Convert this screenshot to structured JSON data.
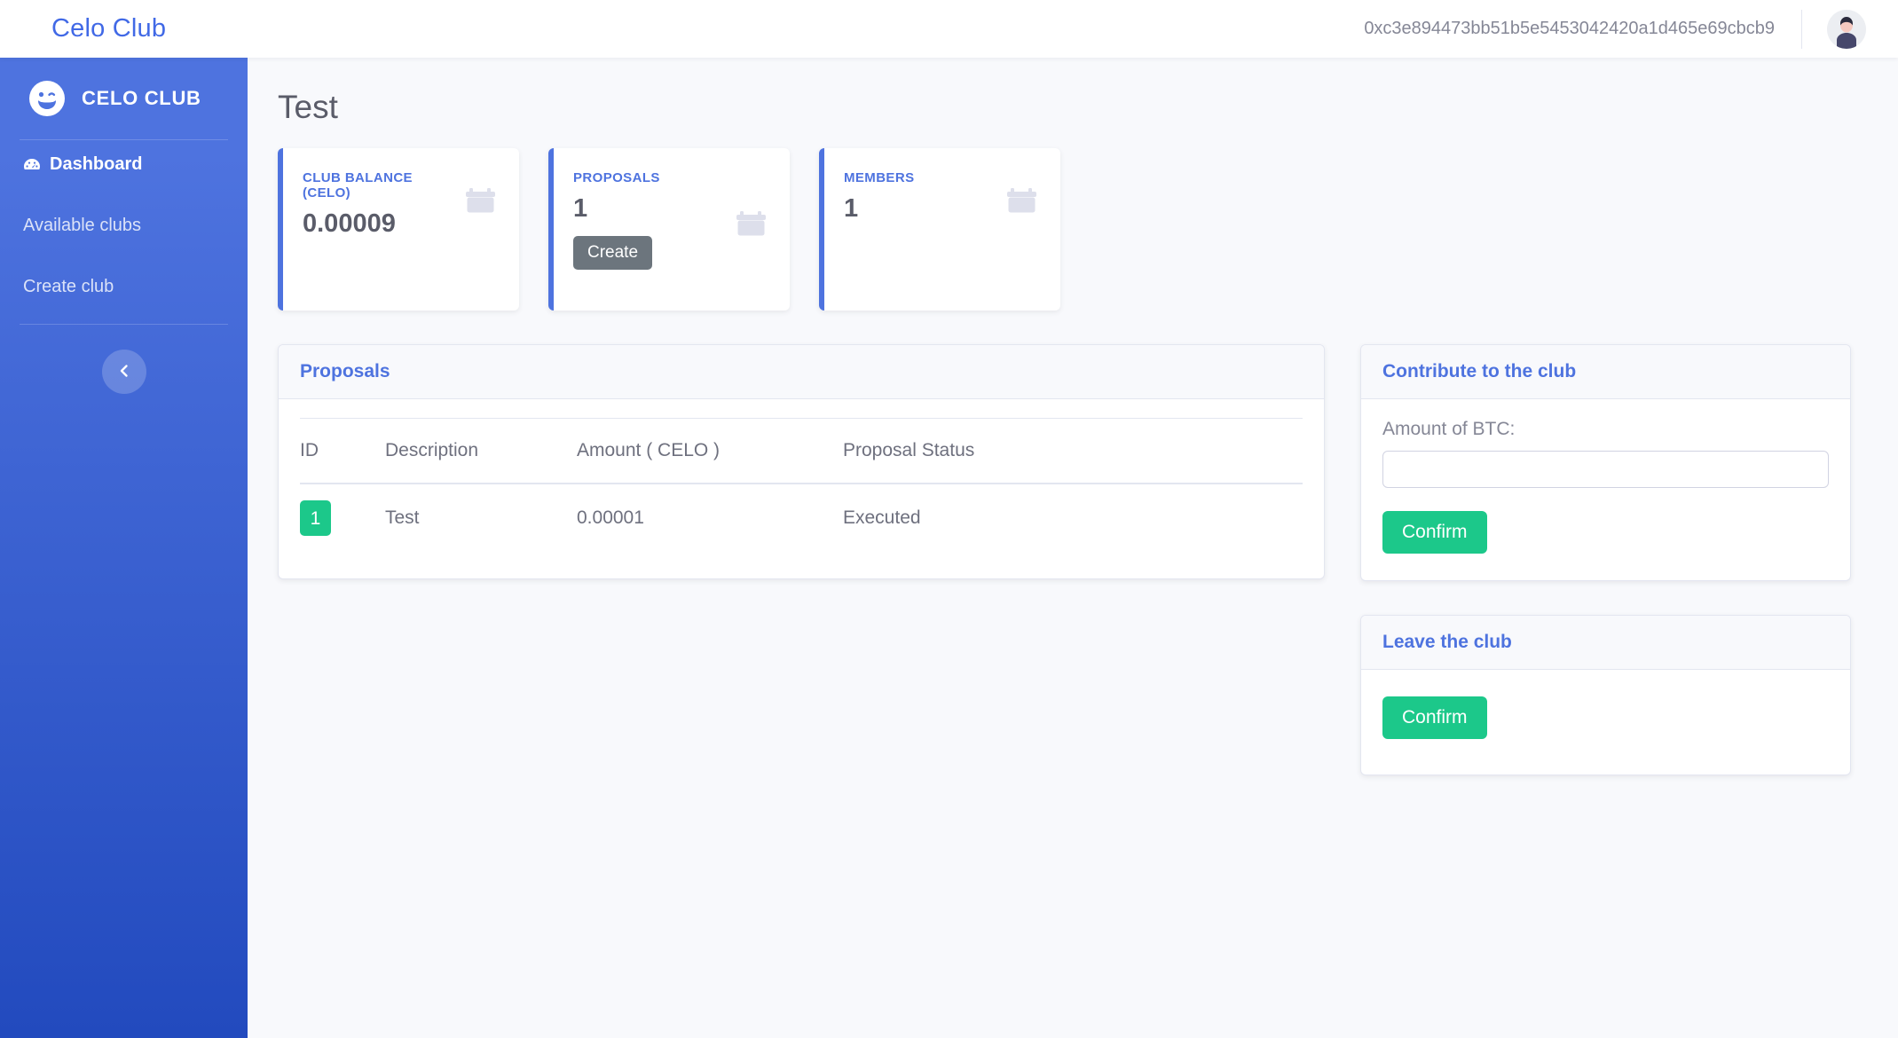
{
  "topbar": {
    "brand": "Celo Club",
    "wallet_address": "0xc3e894473bb51b5e5453042420a1d465e69cbcb9",
    "avatar_icon": "user-avatar"
  },
  "sidebar": {
    "brand_text": "CELO CLUB",
    "brand_icon": "grin-wink-icon",
    "items": [
      {
        "label": "Dashboard",
        "icon": "tachometer-icon",
        "active": true
      },
      {
        "label": "Available clubs",
        "icon": "",
        "active": false
      },
      {
        "label": "Create club",
        "icon": "",
        "active": false
      }
    ],
    "toggle_icon": "chevron-left-icon",
    "bg_color": "#4e73df"
  },
  "main": {
    "page_title": "Test",
    "stat_cards": [
      {
        "label": "CLUB BALANCE (CELO)",
        "value": "0.00009",
        "icon": "calendar-icon",
        "accent": "#4e73df",
        "button": null
      },
      {
        "label": "PROPOSALS",
        "value": "1",
        "icon": "calendar-icon",
        "accent": "#4e73df",
        "button": "Create"
      },
      {
        "label": "MEMBERS",
        "value": "1",
        "icon": "calendar-icon",
        "accent": "#4e73df",
        "button": null
      }
    ],
    "proposals_panel": {
      "title": "Proposals",
      "columns": [
        "ID",
        "Description",
        "Amount ( CELO )",
        "Proposal Status"
      ],
      "rows": [
        {
          "id": "1",
          "description": "Test",
          "amount": "0.00001",
          "status": "Executed"
        }
      ]
    },
    "contribute_panel": {
      "title": "Contribute to the club",
      "field_label": "Amount of BTC:",
      "field_value": "",
      "field_placeholder": "",
      "confirm_label": "Confirm"
    },
    "leave_panel": {
      "title": "Leave the club",
      "confirm_label": "Confirm"
    }
  },
  "colors": {
    "primary": "#4e73df",
    "success": "#1cc88a",
    "secondary": "#6c757d",
    "text_muted": "#858796",
    "page_bg": "#f8f9fc"
  }
}
